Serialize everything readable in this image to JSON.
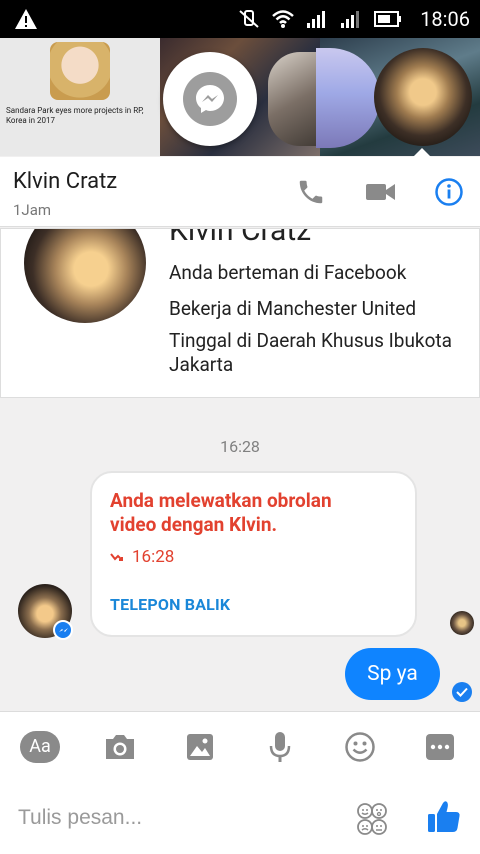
{
  "status_bar": {
    "time": "18:06",
    "icons": [
      "warning-icon",
      "mute-icon",
      "wifi-icon",
      "signal-icon",
      "signal-2-icon",
      "battery-icon"
    ]
  },
  "chat_heads": {
    "news_caption": "Sandara Park eyes more projects in RP, Korea in 2017"
  },
  "header": {
    "name": "Klvin Cratz",
    "status": "1Jam"
  },
  "profile": {
    "name": "Klvin Cratz",
    "line1": "Anda berteman di Facebook",
    "line2": "Bekerja di Manchester United",
    "line3": "Tinggal di Daerah Khusus Ibukota Jakarta"
  },
  "conversation": {
    "timestamp": "16:28",
    "missed_call": {
      "title": "Anda melewatkan obrolan video dengan Klvin.",
      "time": "16:28",
      "action": "TELEPON BALIK"
    },
    "my_message": "Sp ya"
  },
  "composer": {
    "aa_label": "Aa",
    "placeholder": "Tulis pesan..."
  },
  "colors": {
    "accent": "#0f84ff",
    "missed": "#e2412f",
    "link": "#1a87d8"
  }
}
